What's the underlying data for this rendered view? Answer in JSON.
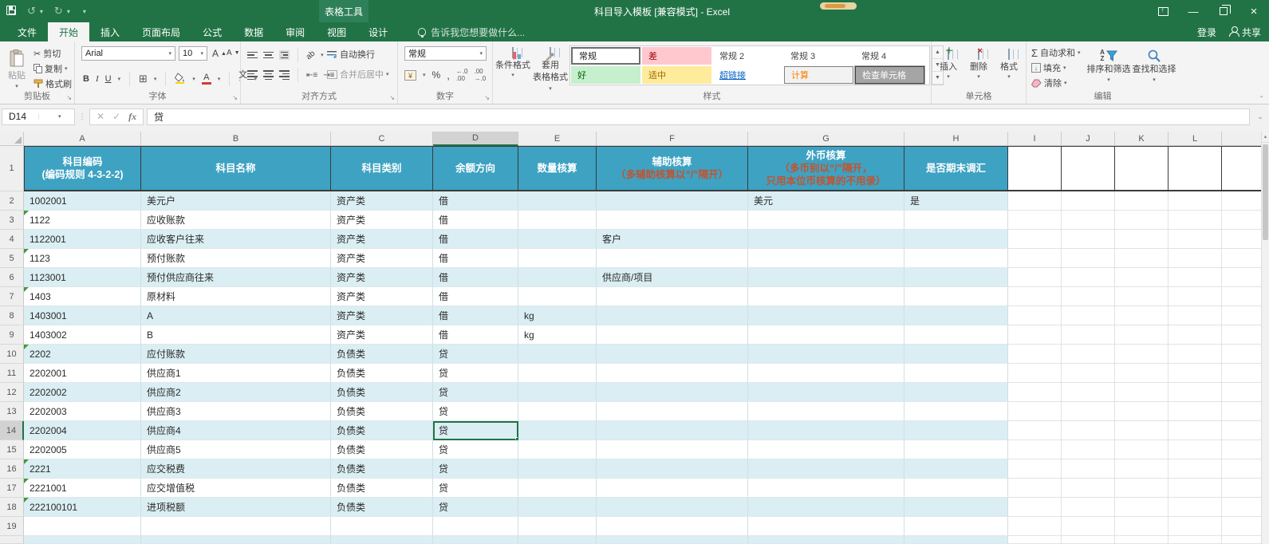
{
  "window": {
    "title": "科目导入模板  [兼容模式] - Excel",
    "context_tool": "表格工具",
    "sign_in": "登录",
    "share": "共享"
  },
  "tabs": [
    {
      "label": "文件",
      "active": false
    },
    {
      "label": "开始",
      "active": true
    },
    {
      "label": "插入",
      "active": false
    },
    {
      "label": "页面布局",
      "active": false
    },
    {
      "label": "公式",
      "active": false
    },
    {
      "label": "数据",
      "active": false
    },
    {
      "label": "审阅",
      "active": false
    },
    {
      "label": "视图",
      "active": false
    },
    {
      "label": "设计",
      "active": false
    }
  ],
  "tell_me": "告诉我您想要做什么...",
  "ribbon": {
    "clipboard": {
      "label": "剪贴板",
      "paste": "粘贴",
      "cut": "剪切",
      "copy": "复制",
      "format_painter": "格式刷"
    },
    "font": {
      "label": "字体",
      "font_name": "Arial",
      "font_size": "10"
    },
    "alignment": {
      "label": "对齐方式",
      "wrap_text": "自动换行",
      "merge_center": "合并后居中"
    },
    "number": {
      "label": "数字",
      "format": "常规"
    },
    "styles": {
      "label": "样式",
      "conditional_line1": "条件格式",
      "format_table_line1": "套用",
      "format_table_line2": "表格格式",
      "gallery": [
        {
          "label": "常规",
          "variant": "selected"
        },
        {
          "label": "差",
          "variant": "bad"
        },
        {
          "label": "常规 2",
          "variant": "plain"
        },
        {
          "label": "常规 3",
          "variant": "plain"
        },
        {
          "label": "常规 4",
          "variant": "plain"
        },
        {
          "label": "好",
          "variant": "good"
        },
        {
          "label": "适中",
          "variant": "neutral"
        },
        {
          "label": "超链接",
          "variant": "link"
        },
        {
          "label": "计算",
          "variant": "calc"
        },
        {
          "label": "检查单元格",
          "variant": "check"
        }
      ]
    },
    "cells": {
      "label": "单元格",
      "insert": "插入",
      "delete": "删除",
      "format": "格式"
    },
    "editing": {
      "label": "编辑",
      "autosum": "自动求和",
      "fill": "填充",
      "clear": "清除",
      "sort_filter": "排序和筛选",
      "find_select": "查找和选择"
    }
  },
  "formula_bar": {
    "name_box": "D14",
    "value": "贷"
  },
  "sheet": {
    "column_letters": [
      "A",
      "B",
      "C",
      "D",
      "E",
      "F",
      "G",
      "H",
      "I",
      "J",
      "K",
      "L"
    ],
    "selected_column": "D",
    "selected_row": 14,
    "selected_cell": "D14",
    "header_row": {
      "A": [
        {
          "text": "科目编码",
          "accent": false
        },
        {
          "text": "(编码规则 4-3-2-2)",
          "accent": false
        }
      ],
      "B": [
        {
          "text": "科目名称",
          "accent": false
        }
      ],
      "C": [
        {
          "text": "科目类别",
          "accent": false
        }
      ],
      "D": [
        {
          "text": "余额方向",
          "accent": false
        }
      ],
      "E": [
        {
          "text": "数量核算",
          "accent": false
        }
      ],
      "F": [
        {
          "text": "辅助核算",
          "accent": false
        },
        {
          "text": "（多辅助核算以“/”隔开）",
          "accent": true
        }
      ],
      "G": [
        {
          "text": "外币核算",
          "accent": false
        },
        {
          "text": "（多币别以“/”隔开，",
          "accent": true
        },
        {
          "text": "只用本位币核算的不用录）",
          "accent": true
        }
      ],
      "H": [
        {
          "text": "是否期末调汇",
          "accent": false
        }
      ]
    },
    "rows": [
      {
        "n": 2,
        "A": "1002001",
        "B": "美元户",
        "C": "资产类",
        "D": "借",
        "E": "",
        "F": "",
        "G": "美元",
        "H": "是",
        "banded": true,
        "triangle": false
      },
      {
        "n": 3,
        "A": "1122",
        "B": "应收账款",
        "C": "资产类",
        "D": "借",
        "E": "",
        "F": "",
        "G": "",
        "H": "",
        "banded": false,
        "triangle": true
      },
      {
        "n": 4,
        "A": "1122001",
        "B": "应收客户往来",
        "C": "资产类",
        "D": "借",
        "E": "",
        "F": "客户",
        "G": "",
        "H": "",
        "banded": true,
        "triangle": false
      },
      {
        "n": 5,
        "A": "1123",
        "B": "预付账款",
        "C": "资产类",
        "D": "借",
        "E": "",
        "F": "",
        "G": "",
        "H": "",
        "banded": false,
        "triangle": true
      },
      {
        "n": 6,
        "A": "1123001",
        "B": "预付供应商往来",
        "C": "资产类",
        "D": "借",
        "E": "",
        "F": "供应商/项目",
        "G": "",
        "H": "",
        "banded": true,
        "triangle": false
      },
      {
        "n": 7,
        "A": "1403",
        "B": "原材料",
        "C": "资产类",
        "D": "借",
        "E": "",
        "F": "",
        "G": "",
        "H": "",
        "banded": false,
        "triangle": true
      },
      {
        "n": 8,
        "A": "1403001",
        "B": "A",
        "C": "资产类",
        "D": "借",
        "E": "kg",
        "F": "",
        "G": "",
        "H": "",
        "banded": true,
        "triangle": false
      },
      {
        "n": 9,
        "A": "1403002",
        "B": "B",
        "C": "资产类",
        "D": "借",
        "E": "kg",
        "F": "",
        "G": "",
        "H": "",
        "banded": false,
        "triangle": false
      },
      {
        "n": 10,
        "A": "2202",
        "B": "应付账款",
        "C": "负债类",
        "D": "贷",
        "E": "",
        "F": "",
        "G": "",
        "H": "",
        "banded": true,
        "triangle": true
      },
      {
        "n": 11,
        "A": "2202001",
        "B": "供应商1",
        "C": "负债类",
        "D": "贷",
        "E": "",
        "F": "",
        "G": "",
        "H": "",
        "banded": false,
        "triangle": false
      },
      {
        "n": 12,
        "A": "2202002",
        "B": "供应商2",
        "C": "负债类",
        "D": "贷",
        "E": "",
        "F": "",
        "G": "",
        "H": "",
        "banded": true,
        "triangle": false
      },
      {
        "n": 13,
        "A": "2202003",
        "B": "供应商3",
        "C": "负债类",
        "D": "贷",
        "E": "",
        "F": "",
        "G": "",
        "H": "",
        "banded": false,
        "triangle": false
      },
      {
        "n": 14,
        "A": "2202004",
        "B": "供应商4",
        "C": "负债类",
        "D": "贷",
        "E": "",
        "F": "",
        "G": "",
        "H": "",
        "banded": true,
        "triangle": false
      },
      {
        "n": 15,
        "A": "2202005",
        "B": "供应商5",
        "C": "负债类",
        "D": "贷",
        "E": "",
        "F": "",
        "G": "",
        "H": "",
        "banded": false,
        "triangle": false
      },
      {
        "n": 16,
        "A": "2221",
        "B": "应交税费",
        "C": "负债类",
        "D": "贷",
        "E": "",
        "F": "",
        "G": "",
        "H": "",
        "banded": true,
        "triangle": true
      },
      {
        "n": 17,
        "A": "2221001",
        "B": "应交增值税",
        "C": "负债类",
        "D": "贷",
        "E": "",
        "F": "",
        "G": "",
        "H": "",
        "banded": false,
        "triangle": true
      },
      {
        "n": 18,
        "A": "222100101",
        "B": "进项税额",
        "C": "负债类",
        "D": "贷",
        "E": "",
        "F": "",
        "G": "",
        "H": "",
        "banded": true,
        "triangle": true
      },
      {
        "n": 19,
        "A": "",
        "B": "",
        "C": "",
        "D": "",
        "E": "",
        "F": "",
        "G": "",
        "H": "",
        "banded": false,
        "triangle": false
      }
    ]
  },
  "colors": {
    "excel_green": "#217346",
    "table_header_teal": "#3ea2c2",
    "banded_row_blue": "#daeef3",
    "header_accent_text": "#c3532f",
    "style_bad_bg": "#ffc7ce",
    "style_good_bg": "#c6efce",
    "style_neutral_bg": "#ffeb9c",
    "hyperlink_blue": "#0563c1"
  }
}
